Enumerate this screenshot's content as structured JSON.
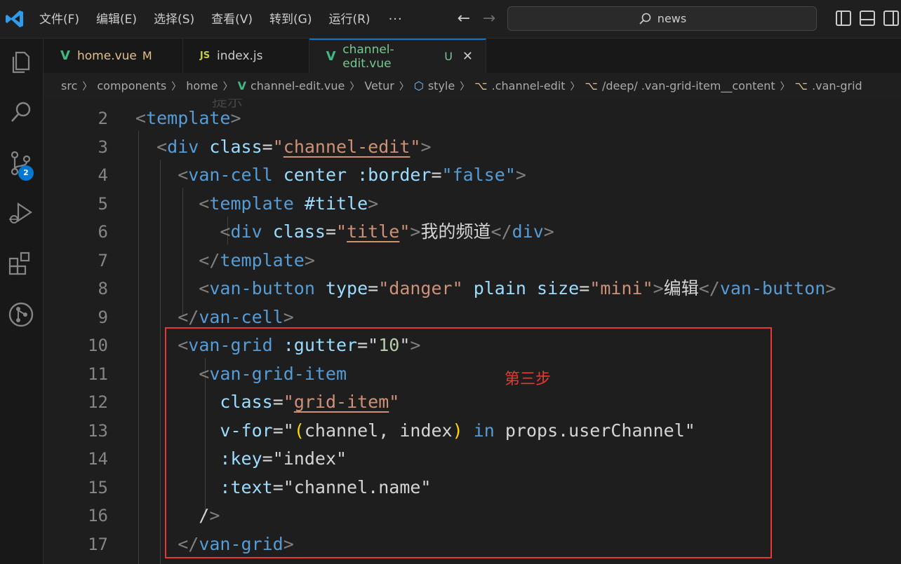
{
  "menu": [
    "文件(F)",
    "编辑(E)",
    "选择(S)",
    "查看(V)",
    "转到(G)",
    "运行(R)"
  ],
  "menu_more": "···",
  "search": {
    "text": "news"
  },
  "activity": {
    "source_control_badge": "2"
  },
  "tabs": [
    {
      "label": "home.vue",
      "status": "M",
      "icon": "vue-icon",
      "color": "#e2c08d"
    },
    {
      "label": "index.js",
      "status": "",
      "icon": "js-icon",
      "color": "#cccccc"
    },
    {
      "label": "channel-edit.vue",
      "status": "U",
      "icon": "vue-icon",
      "color": "#73c991"
    }
  ],
  "breadcrumb": [
    "src",
    "components",
    "home",
    "channel-edit.vue",
    "Vetur",
    "style",
    ".channel-edit",
    "/deep/ .van-grid-item__content",
    ".van-grid"
  ],
  "editor": {
    "ghost_text": "提示",
    "lines": [
      {
        "n": "2",
        "tokens": [
          [
            "<",
            "t-punc"
          ],
          [
            "template",
            "t-tag"
          ],
          [
            ">",
            "t-punc"
          ]
        ]
      },
      {
        "n": "3",
        "tokens": [
          [
            "  <",
            "t-punc"
          ],
          [
            "div",
            "t-tag"
          ],
          [
            " ",
            "t-plain"
          ],
          [
            "class",
            "t-attr"
          ],
          [
            "=",
            "t-plain"
          ],
          [
            "\"",
            "t-str"
          ],
          [
            "channel-edit",
            "t-cls"
          ],
          [
            "\"",
            "t-str"
          ],
          [
            ">",
            "t-punc"
          ]
        ]
      },
      {
        "n": "4",
        "tokens": [
          [
            "    <",
            "t-punc"
          ],
          [
            "van-cell",
            "t-tag"
          ],
          [
            " ",
            "t-plain"
          ],
          [
            "center",
            "t-attr"
          ],
          [
            " ",
            "t-plain"
          ],
          [
            ":border",
            "t-attr"
          ],
          [
            "=",
            "t-plain"
          ],
          [
            "\"false\"",
            "t-tag"
          ],
          [
            ">",
            "t-punc"
          ]
        ]
      },
      {
        "n": "5",
        "tokens": [
          [
            "      <",
            "t-punc"
          ],
          [
            "template",
            "t-tag"
          ],
          [
            " ",
            "t-plain"
          ],
          [
            "#title",
            "t-attr"
          ],
          [
            ">",
            "t-punc"
          ]
        ]
      },
      {
        "n": "6",
        "tokens": [
          [
            "        <",
            "t-punc"
          ],
          [
            "div",
            "t-tag"
          ],
          [
            " ",
            "t-plain"
          ],
          [
            "class",
            "t-attr"
          ],
          [
            "=",
            "t-plain"
          ],
          [
            "\"",
            "t-str"
          ],
          [
            "title",
            "t-cls"
          ],
          [
            "\"",
            "t-str"
          ],
          [
            ">",
            "t-punc"
          ],
          [
            "我的频道",
            "t-plain"
          ],
          [
            "</",
            "t-punc"
          ],
          [
            "div",
            "t-tag"
          ],
          [
            ">",
            "t-punc"
          ]
        ]
      },
      {
        "n": "7",
        "tokens": [
          [
            "      </",
            "t-punc"
          ],
          [
            "template",
            "t-tag"
          ],
          [
            ">",
            "t-punc"
          ]
        ]
      },
      {
        "n": "8",
        "tokens": [
          [
            "      <",
            "t-punc"
          ],
          [
            "van-button",
            "t-tag"
          ],
          [
            " ",
            "t-plain"
          ],
          [
            "type",
            "t-attr"
          ],
          [
            "=",
            "t-plain"
          ],
          [
            "\"danger\"",
            "t-str"
          ],
          [
            " ",
            "t-plain"
          ],
          [
            "plain",
            "t-attr"
          ],
          [
            " ",
            "t-plain"
          ],
          [
            "size",
            "t-attr"
          ],
          [
            "=",
            "t-plain"
          ],
          [
            "\"mini\"",
            "t-str"
          ],
          [
            ">",
            "t-punc"
          ],
          [
            "编辑",
            "t-plain"
          ],
          [
            "</",
            "t-punc"
          ],
          [
            "van-button",
            "t-tag"
          ],
          [
            ">",
            "t-punc"
          ]
        ]
      },
      {
        "n": "9",
        "tokens": [
          [
            "    </",
            "t-punc"
          ],
          [
            "van-cell",
            "t-tag"
          ],
          [
            ">",
            "t-punc"
          ]
        ]
      },
      {
        "n": "10",
        "tokens": [
          [
            "    <",
            "t-punc"
          ],
          [
            "van-grid",
            "t-tag"
          ],
          [
            " ",
            "t-plain"
          ],
          [
            ":gutter",
            "t-attr"
          ],
          [
            "=",
            "t-plain"
          ],
          [
            "\"",
            "t-plain"
          ],
          [
            "10",
            "t-num"
          ],
          [
            "\"",
            "t-plain"
          ],
          [
            ">",
            "t-punc"
          ]
        ]
      },
      {
        "n": "11",
        "tokens": [
          [
            "      <",
            "t-punc"
          ],
          [
            "van-grid-item",
            "t-tag"
          ]
        ]
      },
      {
        "n": "12",
        "tokens": [
          [
            "        ",
            "t-plain"
          ],
          [
            "class",
            "t-attr"
          ],
          [
            "=",
            "t-plain"
          ],
          [
            "\"",
            "t-str"
          ],
          [
            "grid-item",
            "t-cls"
          ],
          [
            "\"",
            "t-str"
          ]
        ]
      },
      {
        "n": "13",
        "tokens": [
          [
            "        ",
            "t-plain"
          ],
          [
            "v-for",
            "t-attr"
          ],
          [
            "=",
            "t-plain"
          ],
          [
            "\"",
            "t-plain"
          ],
          [
            "(",
            "t-paren"
          ],
          [
            "channel, index",
            "t-plain"
          ],
          [
            ")",
            "t-paren"
          ],
          [
            " ",
            "t-plain"
          ],
          [
            "in",
            "t-kw"
          ],
          [
            " props.userChannel\"",
            "t-plain"
          ]
        ]
      },
      {
        "n": "14",
        "tokens": [
          [
            "        ",
            "t-plain"
          ],
          [
            ":key",
            "t-attr"
          ],
          [
            "=",
            "t-plain"
          ],
          [
            "\"index\"",
            "t-plain"
          ]
        ]
      },
      {
        "n": "15",
        "tokens": [
          [
            "        ",
            "t-plain"
          ],
          [
            ":text",
            "t-attr"
          ],
          [
            "=",
            "t-plain"
          ],
          [
            "\"channel.name\"",
            "t-plain"
          ]
        ]
      },
      {
        "n": "16",
        "tokens": [
          [
            "      /",
            "t-plain"
          ],
          [
            ">",
            "t-punc"
          ]
        ]
      },
      {
        "n": "17",
        "tokens": [
          [
            "    </",
            "t-punc"
          ],
          [
            "van-grid",
            "t-tag"
          ],
          [
            ">",
            "t-punc"
          ]
        ]
      }
    ]
  },
  "annotation": "第三步"
}
